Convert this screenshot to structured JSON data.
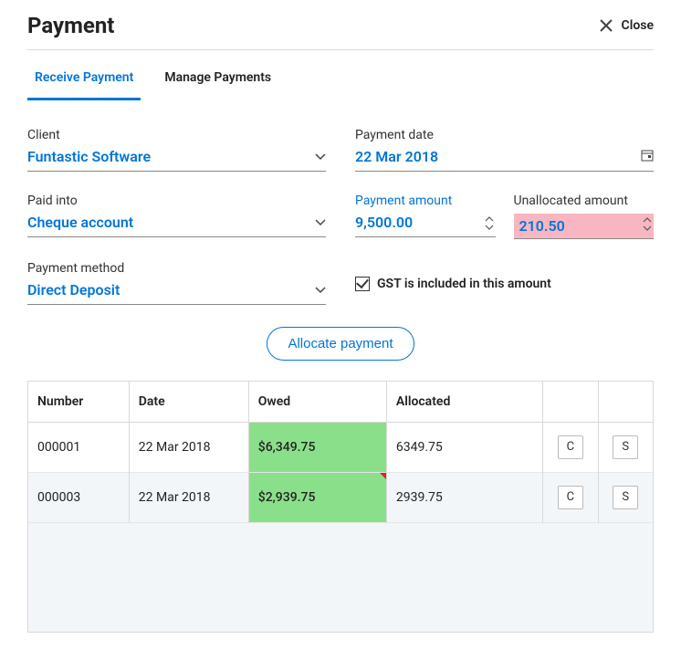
{
  "header": {
    "title": "Payment",
    "close_label": "Close"
  },
  "tabs": {
    "receive": "Receive Payment",
    "manage": "Manage Payments"
  },
  "client": {
    "label": "Client",
    "value": "Funtastic Software"
  },
  "paid_into": {
    "label": "Paid into",
    "value": "Cheque account"
  },
  "payment_method": {
    "label": "Payment method",
    "value": "Direct Deposit"
  },
  "payment_date": {
    "label": "Payment date",
    "value": "22 Mar 2018"
  },
  "payment_amount": {
    "label": "Payment amount",
    "value": "9,500.00"
  },
  "unallocated": {
    "label": "Unallocated amount",
    "value": "210.50"
  },
  "gst": {
    "label": "GST is included in this amount",
    "checked": true
  },
  "allocate_button": "Allocate payment",
  "table": {
    "headers": {
      "number": "Number",
      "date": "Date",
      "owed": "Owed",
      "allocated": "Allocated"
    },
    "rows": [
      {
        "number": "000001",
        "date": "22 Mar 2018",
        "owed": "$6,349.75",
        "allocated": "6349.75",
        "c": "C",
        "s": "S"
      },
      {
        "number": "000003",
        "date": "22 Mar 2018",
        "owed": "$2,939.75",
        "allocated": "2939.75",
        "c": "C",
        "s": "S"
      }
    ]
  }
}
